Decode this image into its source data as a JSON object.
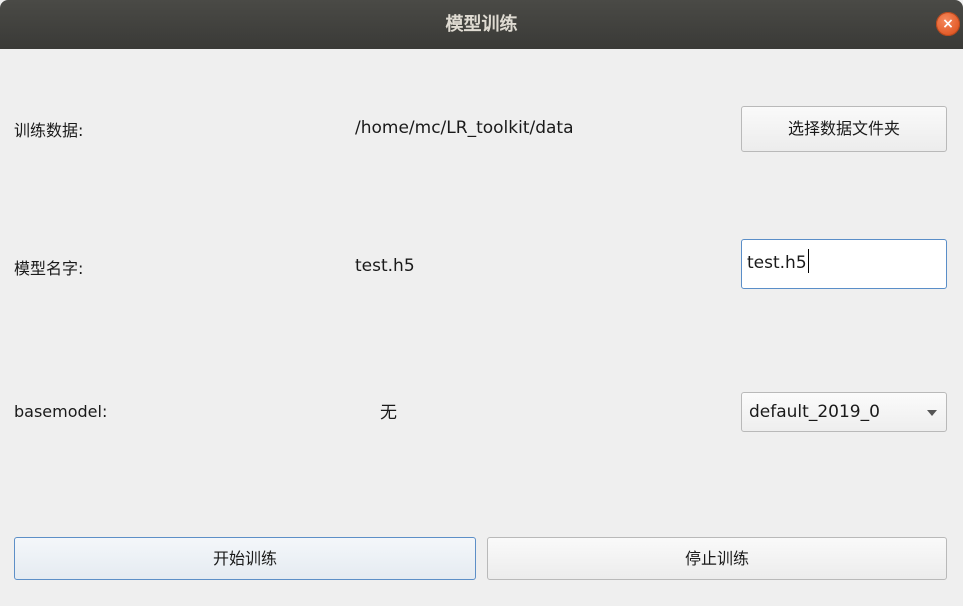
{
  "window": {
    "title": "模型训练",
    "close_glyph": "×"
  },
  "rows": {
    "train_data": {
      "label": "训练数据:",
      "value": "/home/mc/LR_toolkit/data",
      "button_label": "选择数据文件夹"
    },
    "model_name": {
      "label": "模型名字:",
      "value": "test.h5",
      "input_value": "test.h5"
    },
    "basemodel": {
      "label": "basemodel:",
      "value": "无",
      "selected_option": "default_2019_0"
    }
  },
  "actions": {
    "start_label": "开始训练",
    "stop_label": "停止训练"
  },
  "colors": {
    "titlebar": "#3e3e3b",
    "close_button": "#e8622f",
    "focus_border": "#5a8ec8",
    "window_bg": "#efefef"
  }
}
